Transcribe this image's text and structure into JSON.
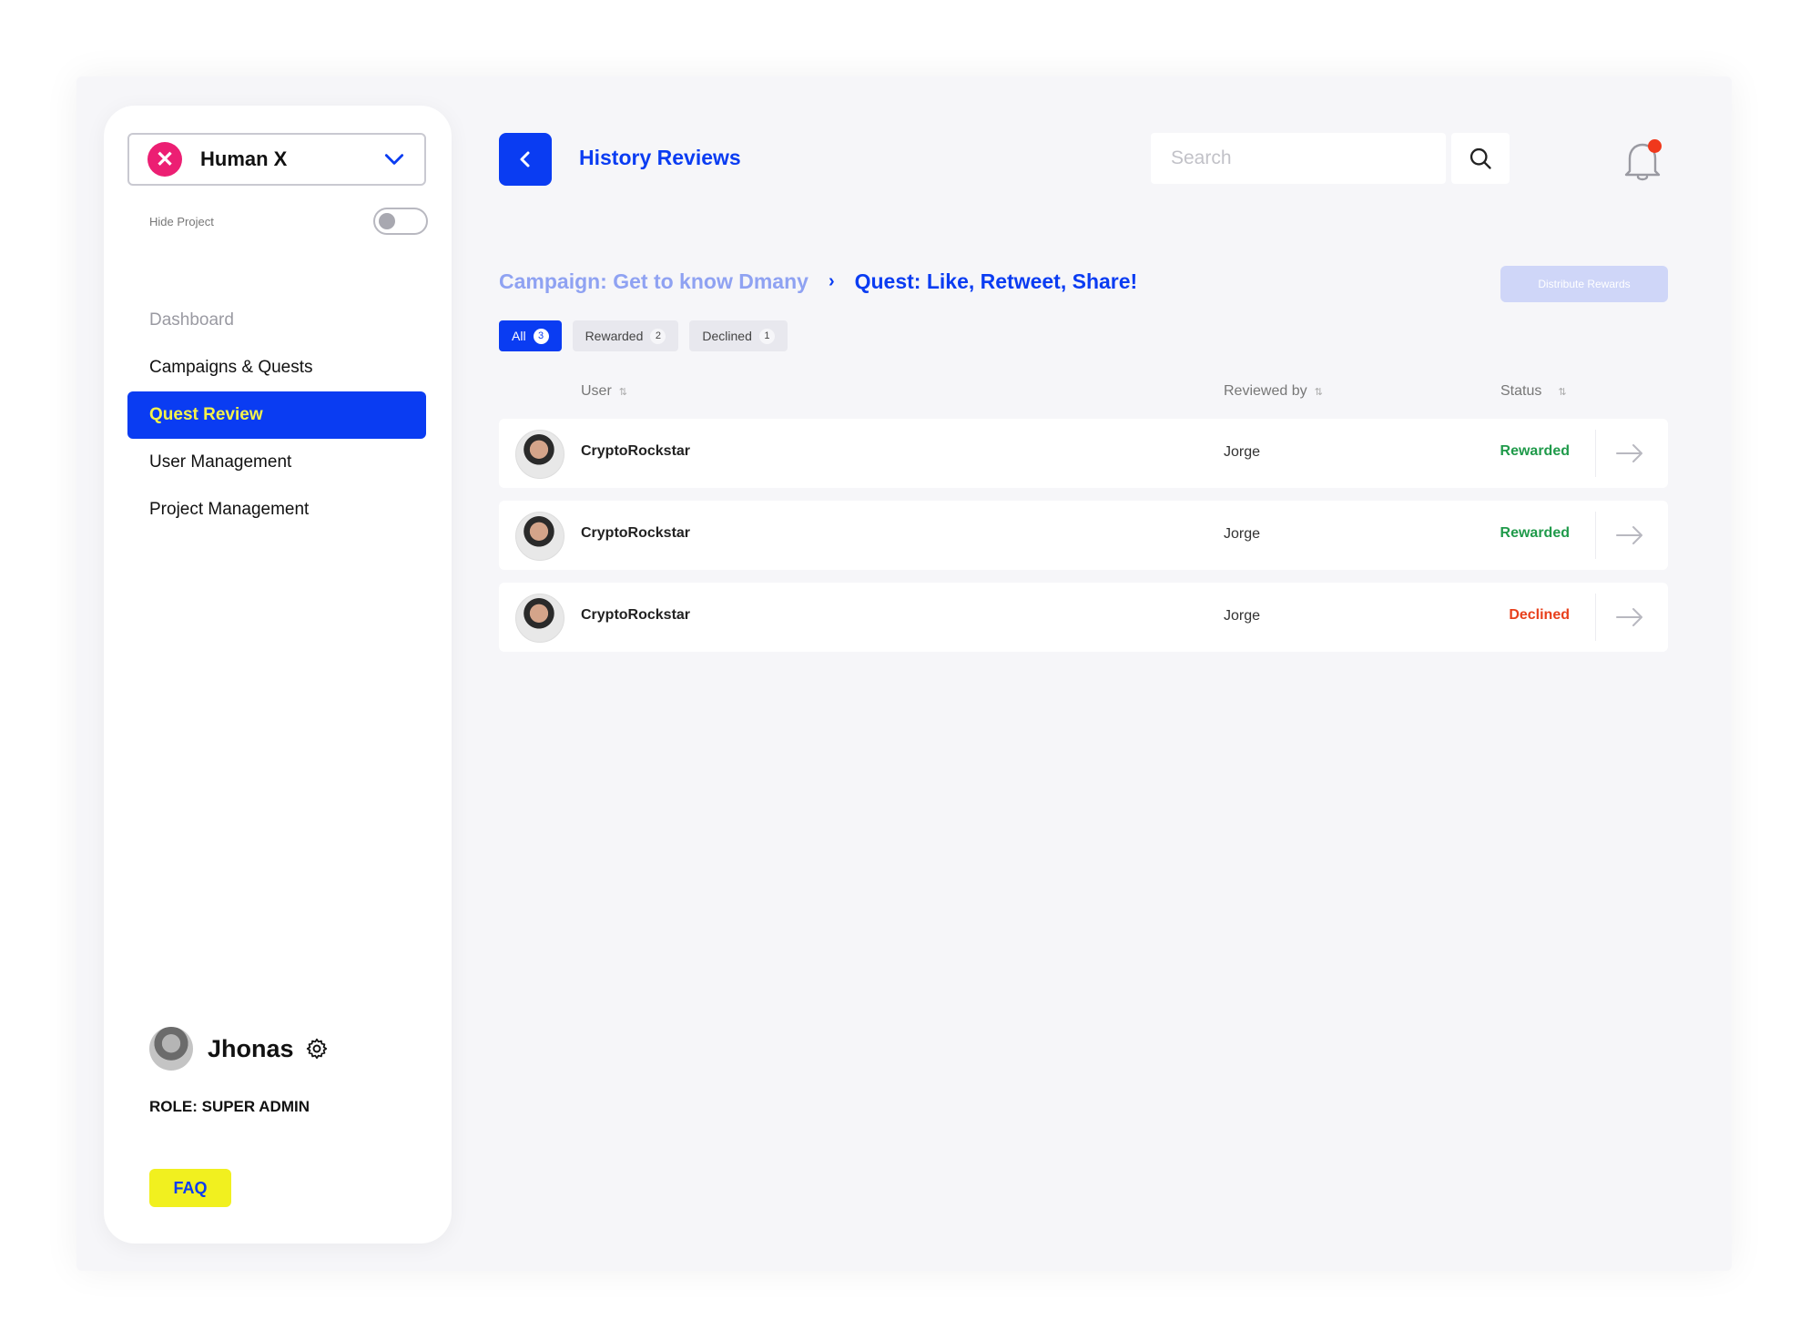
{
  "sidebar": {
    "project": {
      "name": "Human X",
      "logo_glyph": "✕",
      "logo_color": "#ec1f73"
    },
    "hide_project_label": "Hide Project",
    "hide_project_on": false,
    "nav": [
      {
        "label": "Dashboard",
        "state": "muted"
      },
      {
        "label": "Campaigns & Quests",
        "state": "normal"
      },
      {
        "label": "Quest Review",
        "state": "active"
      },
      {
        "label": "User Management",
        "state": "normal"
      },
      {
        "label": "Project Management",
        "state": "normal"
      }
    ],
    "user": {
      "name": "Jhonas",
      "role": "ROLE: SUPER ADMIN"
    },
    "faq_label": "FAQ"
  },
  "header": {
    "title": "History Reviews",
    "search_placeholder": "Search",
    "search_value": "",
    "notification_unread": true
  },
  "breadcrumb": {
    "campaign": "Campaign: Get to know Dmany",
    "separator": "›",
    "quest": "Quest: Like, Retweet, Share!"
  },
  "distribute_label": "Distribute Rewards",
  "tabs": [
    {
      "label": "All",
      "count": "3",
      "active": true
    },
    {
      "label": "Rewarded",
      "count": "2",
      "active": false
    },
    {
      "label": "Declined",
      "count": "1",
      "active": false
    }
  ],
  "table": {
    "columns": {
      "user": "User",
      "reviewed_by": "Reviewed by",
      "status": "Status"
    },
    "sort_glyph": "⇅",
    "rows": [
      {
        "user": "CryptoRockstar",
        "reviewed_by": "Jorge",
        "status": "Rewarded"
      },
      {
        "user": "CryptoRockstar",
        "reviewed_by": "Jorge",
        "status": "Rewarded"
      },
      {
        "user": "CryptoRockstar",
        "reviewed_by": "Jorge",
        "status": "Declined"
      }
    ]
  },
  "colors": {
    "primary": "#0a3cf2",
    "accent_yellow": "#f1f01f",
    "rewarded": "#1f9a4a",
    "declined": "#e8401c",
    "notification_dot": "#f0381c"
  },
  "icons": {
    "dropdown": "chevron-down-icon",
    "settings": "gear-icon",
    "back": "chevron-left-icon",
    "search": "search-icon",
    "notifications": "bell-icon",
    "open_row": "arrow-right-icon",
    "sort": "sort-icon"
  }
}
